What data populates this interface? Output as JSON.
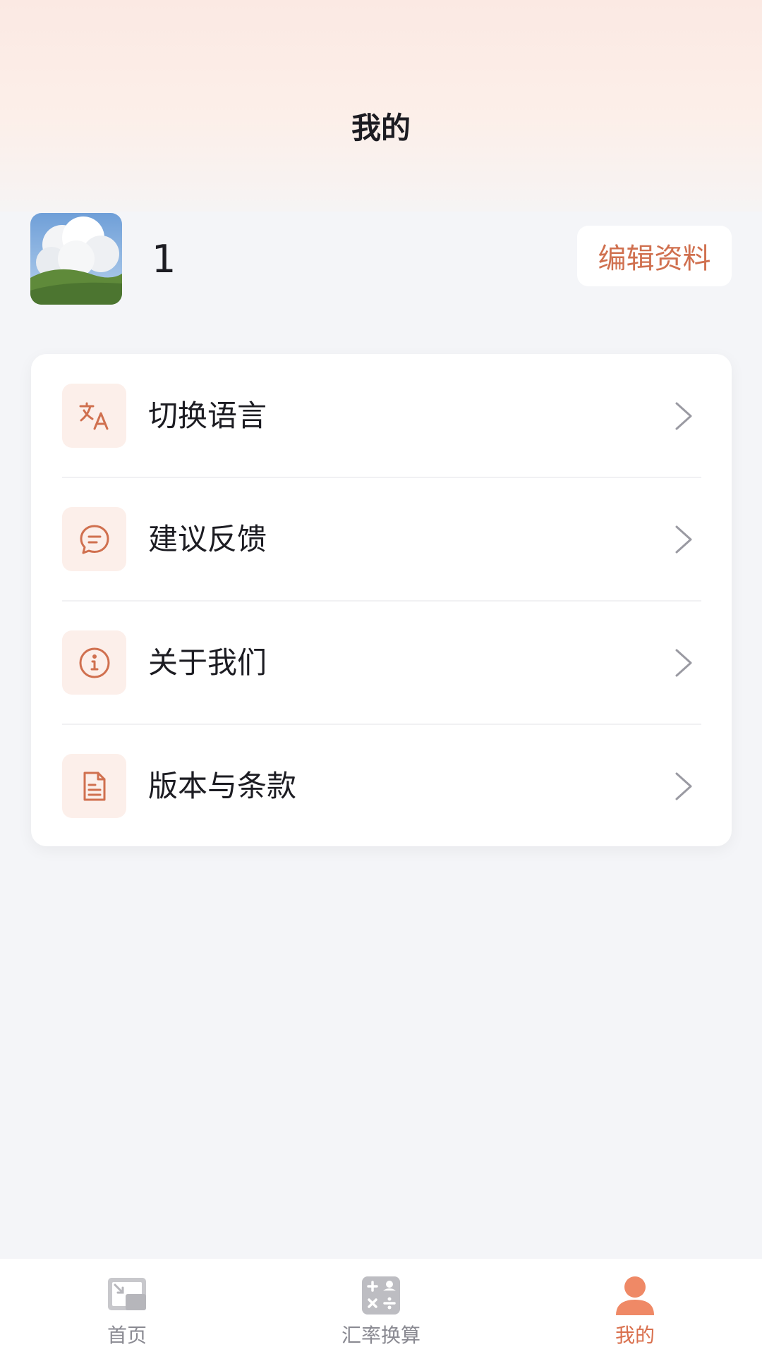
{
  "header": {
    "title": "我的"
  },
  "profile": {
    "username": "1",
    "edit_label": "编辑资料"
  },
  "menu": {
    "items": [
      {
        "label": "切换语言",
        "icon": "translate-icon"
      },
      {
        "label": "建议反馈",
        "icon": "chat-bubble-icon"
      },
      {
        "label": "关于我们",
        "icon": "info-icon"
      },
      {
        "label": "版本与条款",
        "icon": "document-icon"
      }
    ]
  },
  "tabbar": {
    "tabs": [
      {
        "label": "首页",
        "icon": "home-screen-icon",
        "active": false
      },
      {
        "label": "汇率换算",
        "icon": "calculator-icon",
        "active": false
      },
      {
        "label": "我的",
        "icon": "person-icon",
        "active": true
      }
    ]
  },
  "colors": {
    "accent": "#d9704e",
    "icon_bg": "#fcefea",
    "page_bg": "#f4f5f8",
    "header_bg": "#fbe9e3"
  }
}
